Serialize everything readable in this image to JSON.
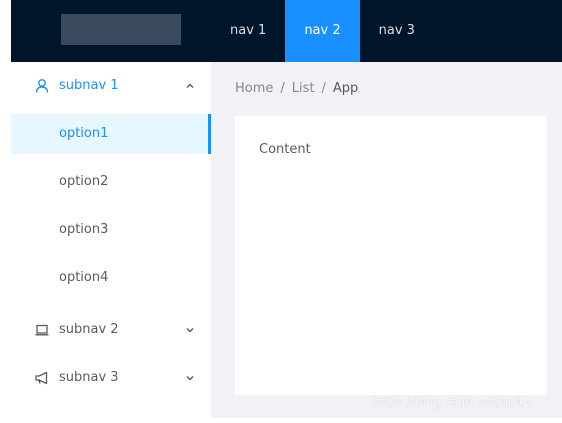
{
  "header": {
    "nav": [
      {
        "label": "nav 1"
      },
      {
        "label": "nav 2"
      },
      {
        "label": "nav 3"
      }
    ],
    "selected_nav": "nav 2"
  },
  "sidebar": {
    "submenus": [
      {
        "label": "subnav 1",
        "icon": "user-icon",
        "state": "expanded",
        "options": [
          "option1",
          "option2",
          "option3",
          "option4"
        ],
        "selected_option": "option1"
      },
      {
        "label": "subnav 2",
        "icon": "laptop-icon",
        "state": "collapsed"
      },
      {
        "label": "subnav 3",
        "icon": "notification-icon",
        "state": "collapsed"
      }
    ]
  },
  "breadcrumb": [
    "Home",
    "List",
    "App"
  ],
  "content": {
    "text": "Content"
  },
  "watermark": "https://blog.csdn.net/quitv",
  "colors": {
    "header_bg": "#001529",
    "accent": "#1890ff",
    "selected_bg": "#e6f7ff",
    "layout_bg": "#f0f2f5"
  }
}
